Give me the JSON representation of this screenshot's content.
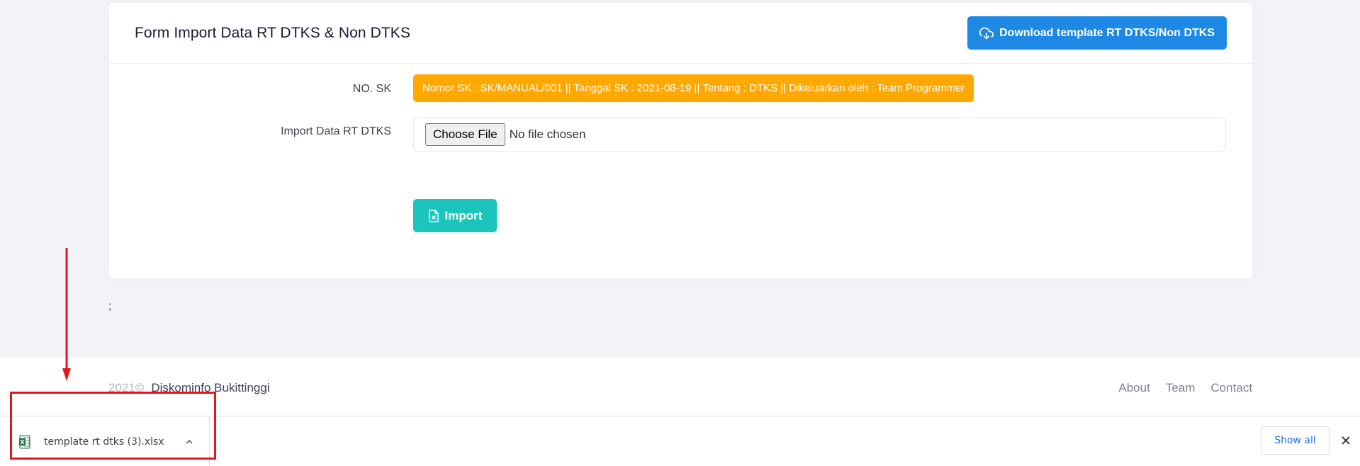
{
  "card": {
    "title": "Form Import Data RT DTKS & Non DTKS",
    "download_button_label": "Download template RT DTKS/Non DTKS"
  },
  "form": {
    "sk_label": "NO. SK",
    "sk_value": "Nomor SK : SK/MANUAL/001 || Tanggal SK : 2021-08-19 || Tentang : DTKS || Dikeluarkan oleh : Team Programmer",
    "import_label": "Import Data RT DTKS",
    "choose_file_label": "Choose File",
    "no_file_text": "No file chosen",
    "import_button_label": "Import"
  },
  "stray_text": ";",
  "footer": {
    "year": "2021©",
    "org": "Diskominfo Bukittinggi",
    "links": [
      "About",
      "Team",
      "Contact"
    ]
  },
  "download_bar": {
    "file_name": "template rt dtks (3).xlsx",
    "show_all_label": "Show all"
  },
  "icons": {
    "download": "cloud-download-icon",
    "import": "excel-file-icon",
    "file": "xlsx-file-icon",
    "caret": "chevron-up-icon",
    "close": "close-icon"
  },
  "colors": {
    "primary": "#1e88e5",
    "warning": "#ffa800",
    "success": "#1bc5bd",
    "annotation": "#e8141b",
    "link": "#1a73e8"
  }
}
